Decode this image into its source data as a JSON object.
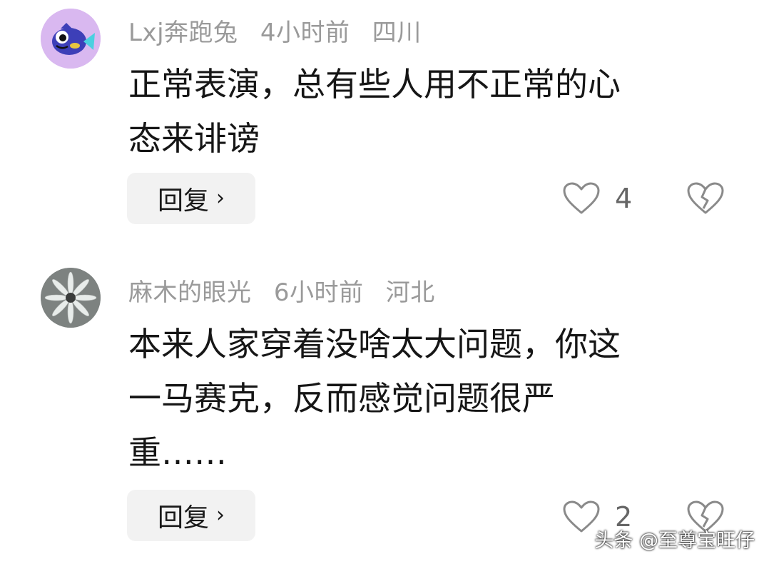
{
  "comments": [
    {
      "username": "Lxj奔跑兔",
      "time": "4小时前",
      "location": "四川",
      "text_lines": [
        "正常表演，总有些人用不正常的心",
        "态来诽谤"
      ],
      "reply_label": "回复",
      "like_count": "4"
    },
    {
      "username": "麻木的眼光",
      "time": "6小时前",
      "location": "河北",
      "text_lines": [
        "本来人家穿着没啥太大问题，你这",
        "一马赛克，反而感觉问题很严",
        "重……"
      ],
      "reply_label": "回复",
      "like_count": "2"
    }
  ],
  "icons": {
    "reply_chevron": "chevron-right-icon",
    "like": "heart-icon",
    "dislike": "broken-heart-icon"
  },
  "watermark": "头条 @至尊宝旺仔"
}
